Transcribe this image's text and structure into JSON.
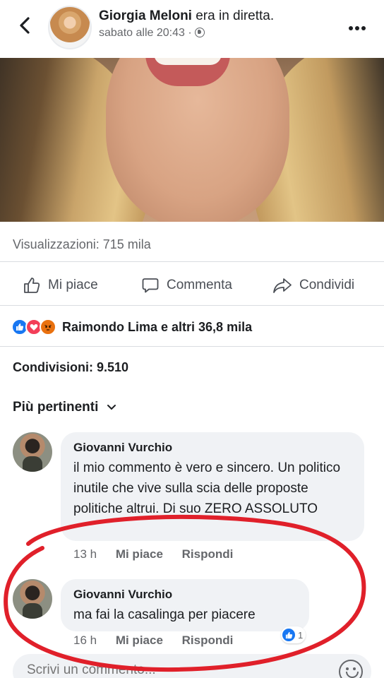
{
  "header": {
    "name": "Giorgia Meloni",
    "status": "era in diretta.",
    "timestamp": "sabato alle 20:43 ·",
    "privacy_icon": "globe-icon"
  },
  "post": {
    "views": "Visualizzazioni: 715 mila",
    "actions": {
      "like": "Mi piace",
      "comment": "Commenta",
      "share": "Condividi"
    },
    "reactions": {
      "icons": [
        "like",
        "love",
        "angry"
      ],
      "summary": "Raimondo Lima e altri 36,8 mila"
    },
    "shares": "Condivisioni: 9.510",
    "sort_label": "Più pertinenti"
  },
  "comments": [
    {
      "author": "Giovanni Vurchio",
      "text": "il mio commento è vero e sincero. Un politico inutile che vive sulla scia delle proposte politiche altrui. Di suo ZERO ASSOLUTO",
      "time": "13 h",
      "like": "Mi piace",
      "reply": "Rispondi"
    },
    {
      "author": "Giovanni Vurchio",
      "text": "ma fai la casalinga per piacere",
      "time": "16 h",
      "like": "Mi piace",
      "reply": "Rispondi",
      "reaction_count": "1"
    }
  ],
  "composer": {
    "placeholder": "Scrivi un commento..."
  },
  "colors": {
    "accent": "#1877f2",
    "annotation": "#e0202a"
  }
}
